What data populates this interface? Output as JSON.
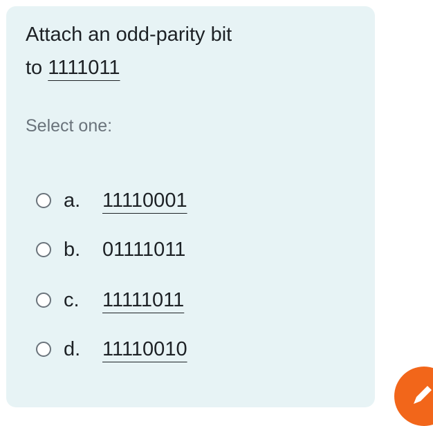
{
  "question": {
    "line1": "Attach an odd-parity bit",
    "prefix": "to",
    "number": "1111011"
  },
  "prompt": "Select one:",
  "options": [
    {
      "letter": "a.",
      "value": "11110001",
      "underlined": true
    },
    {
      "letter": "b.",
      "value": "01111011",
      "underlined": false
    },
    {
      "letter": "c.",
      "value": "11111011",
      "underlined": true
    },
    {
      "letter": "d.",
      "value": "11110010",
      "underlined": true
    }
  ],
  "fab": {
    "icon": "pencil-icon",
    "color": "#f2661a"
  }
}
